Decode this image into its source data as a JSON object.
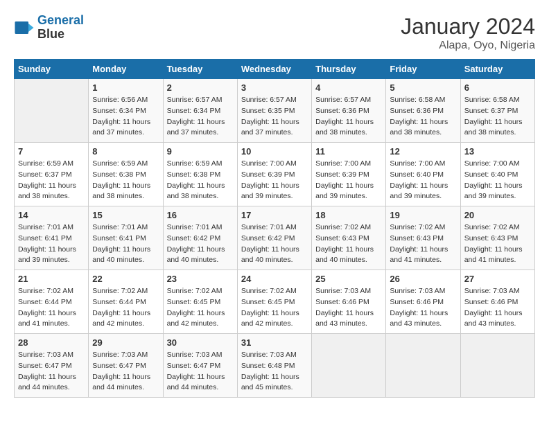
{
  "header": {
    "logo_line1": "General",
    "logo_line2": "Blue",
    "title": "January 2024",
    "subtitle": "Alapa, Oyo, Nigeria"
  },
  "weekdays": [
    "Sunday",
    "Monday",
    "Tuesday",
    "Wednesday",
    "Thursday",
    "Friday",
    "Saturday"
  ],
  "weeks": [
    [
      {
        "day": "",
        "sunrise": "",
        "sunset": "",
        "daylight": ""
      },
      {
        "day": "1",
        "sunrise": "Sunrise: 6:56 AM",
        "sunset": "Sunset: 6:34 PM",
        "daylight": "Daylight: 11 hours and 37 minutes."
      },
      {
        "day": "2",
        "sunrise": "Sunrise: 6:57 AM",
        "sunset": "Sunset: 6:34 PM",
        "daylight": "Daylight: 11 hours and 37 minutes."
      },
      {
        "day": "3",
        "sunrise": "Sunrise: 6:57 AM",
        "sunset": "Sunset: 6:35 PM",
        "daylight": "Daylight: 11 hours and 37 minutes."
      },
      {
        "day": "4",
        "sunrise": "Sunrise: 6:57 AM",
        "sunset": "Sunset: 6:36 PM",
        "daylight": "Daylight: 11 hours and 38 minutes."
      },
      {
        "day": "5",
        "sunrise": "Sunrise: 6:58 AM",
        "sunset": "Sunset: 6:36 PM",
        "daylight": "Daylight: 11 hours and 38 minutes."
      },
      {
        "day": "6",
        "sunrise": "Sunrise: 6:58 AM",
        "sunset": "Sunset: 6:37 PM",
        "daylight": "Daylight: 11 hours and 38 minutes."
      }
    ],
    [
      {
        "day": "7",
        "sunrise": "Sunrise: 6:59 AM",
        "sunset": "Sunset: 6:37 PM",
        "daylight": "Daylight: 11 hours and 38 minutes."
      },
      {
        "day": "8",
        "sunrise": "Sunrise: 6:59 AM",
        "sunset": "Sunset: 6:38 PM",
        "daylight": "Daylight: 11 hours and 38 minutes."
      },
      {
        "day": "9",
        "sunrise": "Sunrise: 6:59 AM",
        "sunset": "Sunset: 6:38 PM",
        "daylight": "Daylight: 11 hours and 38 minutes."
      },
      {
        "day": "10",
        "sunrise": "Sunrise: 7:00 AM",
        "sunset": "Sunset: 6:39 PM",
        "daylight": "Daylight: 11 hours and 39 minutes."
      },
      {
        "day": "11",
        "sunrise": "Sunrise: 7:00 AM",
        "sunset": "Sunset: 6:39 PM",
        "daylight": "Daylight: 11 hours and 39 minutes."
      },
      {
        "day": "12",
        "sunrise": "Sunrise: 7:00 AM",
        "sunset": "Sunset: 6:40 PM",
        "daylight": "Daylight: 11 hours and 39 minutes."
      },
      {
        "day": "13",
        "sunrise": "Sunrise: 7:00 AM",
        "sunset": "Sunset: 6:40 PM",
        "daylight": "Daylight: 11 hours and 39 minutes."
      }
    ],
    [
      {
        "day": "14",
        "sunrise": "Sunrise: 7:01 AM",
        "sunset": "Sunset: 6:41 PM",
        "daylight": "Daylight: 11 hours and 39 minutes."
      },
      {
        "day": "15",
        "sunrise": "Sunrise: 7:01 AM",
        "sunset": "Sunset: 6:41 PM",
        "daylight": "Daylight: 11 hours and 40 minutes."
      },
      {
        "day": "16",
        "sunrise": "Sunrise: 7:01 AM",
        "sunset": "Sunset: 6:42 PM",
        "daylight": "Daylight: 11 hours and 40 minutes."
      },
      {
        "day": "17",
        "sunrise": "Sunrise: 7:01 AM",
        "sunset": "Sunset: 6:42 PM",
        "daylight": "Daylight: 11 hours and 40 minutes."
      },
      {
        "day": "18",
        "sunrise": "Sunrise: 7:02 AM",
        "sunset": "Sunset: 6:43 PM",
        "daylight": "Daylight: 11 hours and 40 minutes."
      },
      {
        "day": "19",
        "sunrise": "Sunrise: 7:02 AM",
        "sunset": "Sunset: 6:43 PM",
        "daylight": "Daylight: 11 hours and 41 minutes."
      },
      {
        "day": "20",
        "sunrise": "Sunrise: 7:02 AM",
        "sunset": "Sunset: 6:43 PM",
        "daylight": "Daylight: 11 hours and 41 minutes."
      }
    ],
    [
      {
        "day": "21",
        "sunrise": "Sunrise: 7:02 AM",
        "sunset": "Sunset: 6:44 PM",
        "daylight": "Daylight: 11 hours and 41 minutes."
      },
      {
        "day": "22",
        "sunrise": "Sunrise: 7:02 AM",
        "sunset": "Sunset: 6:44 PM",
        "daylight": "Daylight: 11 hours and 42 minutes."
      },
      {
        "day": "23",
        "sunrise": "Sunrise: 7:02 AM",
        "sunset": "Sunset: 6:45 PM",
        "daylight": "Daylight: 11 hours and 42 minutes."
      },
      {
        "day": "24",
        "sunrise": "Sunrise: 7:02 AM",
        "sunset": "Sunset: 6:45 PM",
        "daylight": "Daylight: 11 hours and 42 minutes."
      },
      {
        "day": "25",
        "sunrise": "Sunrise: 7:03 AM",
        "sunset": "Sunset: 6:46 PM",
        "daylight": "Daylight: 11 hours and 43 minutes."
      },
      {
        "day": "26",
        "sunrise": "Sunrise: 7:03 AM",
        "sunset": "Sunset: 6:46 PM",
        "daylight": "Daylight: 11 hours and 43 minutes."
      },
      {
        "day": "27",
        "sunrise": "Sunrise: 7:03 AM",
        "sunset": "Sunset: 6:46 PM",
        "daylight": "Daylight: 11 hours and 43 minutes."
      }
    ],
    [
      {
        "day": "28",
        "sunrise": "Sunrise: 7:03 AM",
        "sunset": "Sunset: 6:47 PM",
        "daylight": "Daylight: 11 hours and 44 minutes."
      },
      {
        "day": "29",
        "sunrise": "Sunrise: 7:03 AM",
        "sunset": "Sunset: 6:47 PM",
        "daylight": "Daylight: 11 hours and 44 minutes."
      },
      {
        "day": "30",
        "sunrise": "Sunrise: 7:03 AM",
        "sunset": "Sunset: 6:47 PM",
        "daylight": "Daylight: 11 hours and 44 minutes."
      },
      {
        "day": "31",
        "sunrise": "Sunrise: 7:03 AM",
        "sunset": "Sunset: 6:48 PM",
        "daylight": "Daylight: 11 hours and 45 minutes."
      },
      {
        "day": "",
        "sunrise": "",
        "sunset": "",
        "daylight": ""
      },
      {
        "day": "",
        "sunrise": "",
        "sunset": "",
        "daylight": ""
      },
      {
        "day": "",
        "sunrise": "",
        "sunset": "",
        "daylight": ""
      }
    ]
  ]
}
